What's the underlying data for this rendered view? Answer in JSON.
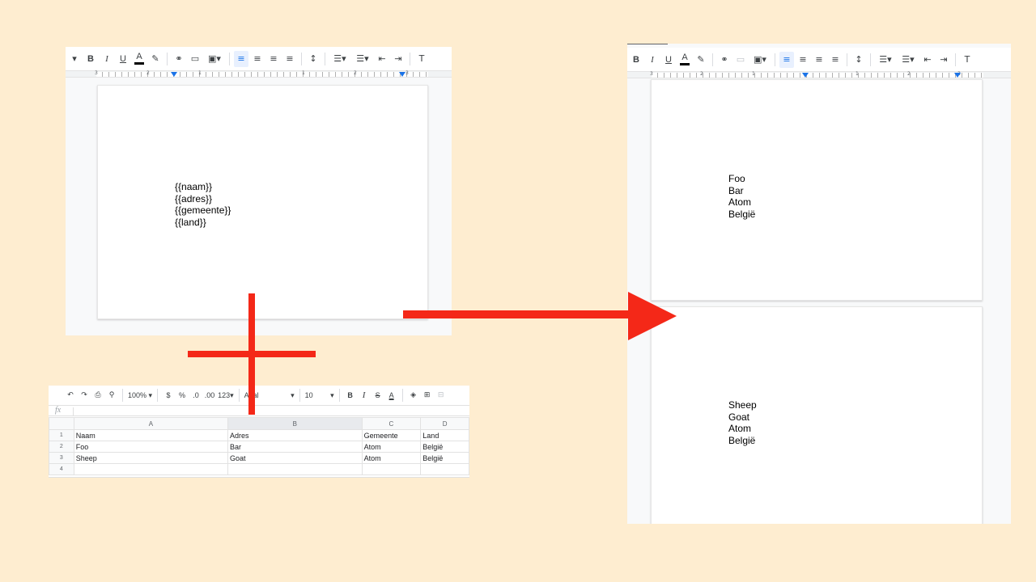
{
  "doc_toolbar": {
    "bold": "B",
    "italic": "I",
    "underline": "U",
    "text_color": "A",
    "clear_format": "T"
  },
  "template_doc": {
    "ruler_numbers": [
      "3",
      "2",
      "1",
      "1",
      "2",
      "3"
    ],
    "lines": [
      "{{naam}}",
      "{{adres}}",
      "{{gemeente}}",
      "{{land}}"
    ]
  },
  "result_doc": {
    "ruler_numbers": [
      "3",
      "2",
      "1",
      "1",
      "2",
      "3"
    ],
    "page1_lines": [
      "Foo",
      "Bar",
      "Atom",
      "België"
    ],
    "page2_lines": [
      "Sheep",
      "Goat",
      "Atom",
      "België"
    ]
  },
  "sheet": {
    "toolbar": {
      "zoom": "100%",
      "currency": "$",
      "percent": "%",
      "dec_less": ".0",
      "dec_more": ".00",
      "format": "123",
      "font": "Arial",
      "font_size": "10",
      "bold": "B",
      "italic": "I",
      "strike": "S",
      "text_color": "A"
    },
    "fx_label": "fx",
    "columns": [
      "A",
      "B",
      "C",
      "D"
    ],
    "rows": [
      {
        "num": "1",
        "cells": [
          "Naam",
          "Adres",
          "Gemeente",
          "Land"
        ]
      },
      {
        "num": "2",
        "cells": [
          "Foo",
          "Bar",
          "Atom",
          "België"
        ]
      },
      {
        "num": "3",
        "cells": [
          "Sheep",
          "Goat",
          "Atom",
          "België"
        ]
      },
      {
        "num": "4",
        "cells": [
          "",
          "",
          "",
          ""
        ]
      }
    ]
  },
  "colors": {
    "background": "#FEEDD0",
    "accent_red": "#F42818",
    "docs_blue": "#1A73E8"
  }
}
